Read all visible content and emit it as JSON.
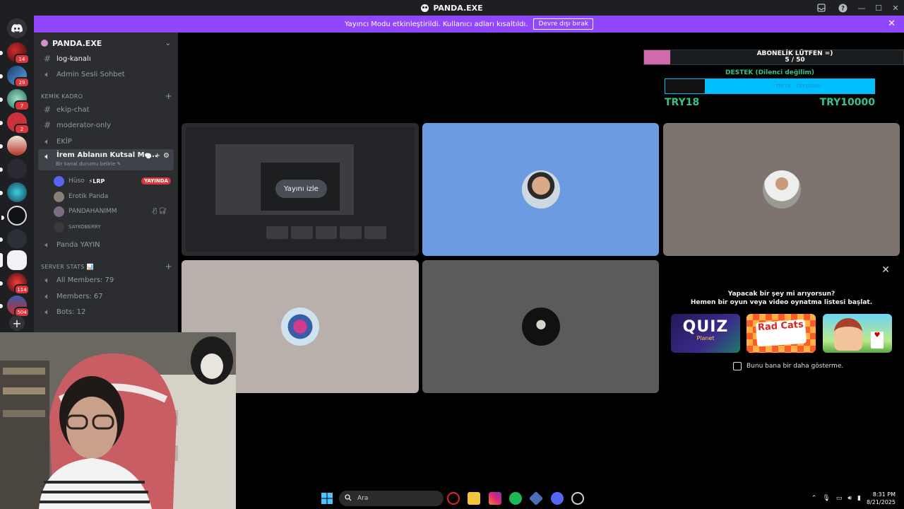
{
  "window": {
    "title": "PANDA.EXE"
  },
  "banner": {
    "message": "Yayıncı Modu etkinleştirildi. Kullanıcı adları kısaltıldı.",
    "button": "Devre dışı bırak",
    "close": "✕"
  },
  "rail": {
    "badges": [
      "14",
      "29",
      "7",
      "2",
      "114",
      "504"
    ]
  },
  "server": {
    "name": "PANDA.EXE",
    "channels_top": [
      {
        "name": "log-kanalı",
        "type": "text"
      },
      {
        "name": "Admin Sesli Sohbet",
        "type": "voice"
      }
    ],
    "category_1": "KEMİK KADRO",
    "channels_mid": [
      {
        "name": "ekip-chat",
        "type": "text"
      },
      {
        "name": "moderator-only",
        "type": "text"
      },
      {
        "name": "EKİP",
        "type": "voice"
      }
    ],
    "active_channel": {
      "name": "İrem Ablanın Kutsal Me...",
      "status": "Bir kanal durumu belirle ✎"
    },
    "voice_users": [
      {
        "name": "Hüso",
        "tag": "⚡LRP",
        "badge": "YAYINDA",
        "color": "#5865f2"
      },
      {
        "name": "Erotik Panda",
        "color": "#8a7f75"
      },
      {
        "name": "PANDAHANIMM",
        "icons": "🎙̸ 🎧̸",
        "color": "#7a6e86"
      },
      {
        "name": "SAYKOBERRY",
        "color": "#3a3a3a"
      }
    ],
    "channel_after": "Panda YAYIN",
    "category_2": "SERVER STATS 📊",
    "stats": [
      {
        "name": "All Members: 79"
      },
      {
        "name": "Members: 67"
      },
      {
        "name": "Bots: 12"
      }
    ]
  },
  "overlay": {
    "goal_label": "ABONELİK LÜTFEN =)",
    "goal_count": "5 / 50",
    "goal_progress": 0.1,
    "support_title": "DESTEK (Dilenci değilim)",
    "support_inner": "TRY18 - TRY10000",
    "support_progress": 0.0018,
    "support_min": "TRY18",
    "support_max": "TRY10000"
  },
  "grid": {
    "watch_button": "Yayını izle"
  },
  "activity": {
    "question": "Yapacak bir şey mi arıyorsun?",
    "subtitle": "Hemen bir oyun veya video oynatma listesi başlat.",
    "games": [
      {
        "title": "QUIZ",
        "subtitle": "Planet"
      },
      {
        "title": "Rad Cats"
      },
      {
        "title": "Solitaire"
      }
    ],
    "checkbox_label": "Bunu bana bir daha gösterme."
  },
  "taskbar": {
    "search_placeholder": "Ara",
    "time": "8:31 PM",
    "date": "8/21/2025"
  }
}
